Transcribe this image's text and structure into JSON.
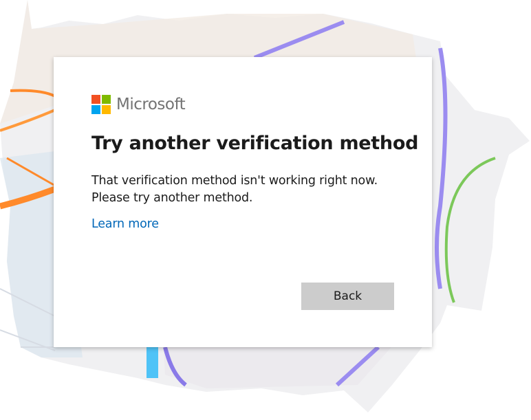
{
  "brand": {
    "name": "Microsoft",
    "logo_colors": [
      "#f25022",
      "#7fba00",
      "#00a4ef",
      "#ffb900"
    ]
  },
  "dialog": {
    "title": "Try another verification method",
    "message_line1": "That verification method isn't working right now.",
    "message_line2": "Please try another method.",
    "learn_more_label": "Learn more",
    "back_label": "Back"
  },
  "colors": {
    "link": "#0067b8",
    "button_bg": "#cccccc",
    "text": "#1b1b1b"
  }
}
